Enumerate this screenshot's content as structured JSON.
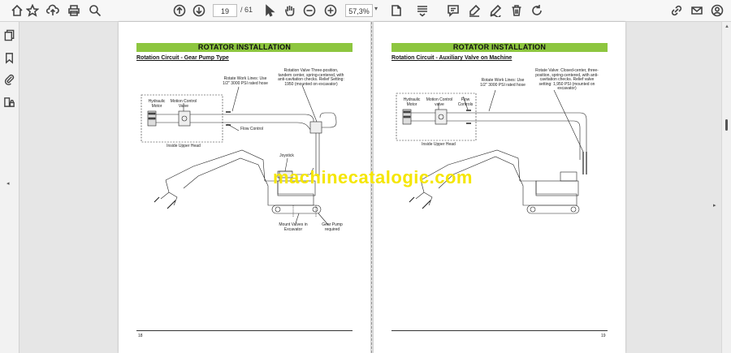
{
  "toolbar": {
    "page_current": "19",
    "page_total": "/ 61",
    "zoom": "57,3%",
    "buttons": [
      "home-icon",
      "star-icon",
      "upload-icon",
      "print-icon",
      "zoom-search-icon",
      "page-up-icon",
      "page-down-icon",
      "select-cursor-icon",
      "hand-icon",
      "zoom-out-icon",
      "zoom-in-icon",
      "fit-page-icon",
      "scroll-mode-icon",
      "comment-icon",
      "highlight-icon",
      "draw-icon",
      "delete-icon",
      "rotate-icon",
      "attach-link-icon",
      "mail-icon",
      "account-icon"
    ]
  },
  "sidebar": {
    "items": [
      "copy-pages-icon",
      "bookmark-icon",
      "attachment-icon",
      "security-icon"
    ]
  },
  "left_page": {
    "banner": "ROTATOR INSTALLATION",
    "subtitle": "Rotation Circuit - Gear Pump Type",
    "labels": {
      "hydraulic_motor": "Hydraulic Motor",
      "motion_control": "Motion Control Valve",
      "rotate_lines": "Rotate Work Lines: Use 1/2\" 3000 PSI rated hose",
      "rotation_valve": "Rotation Valve Three-position, tandem center, spring-centered, with anti-cavitation checks. Relief Setting: 1950 (mounted on excavator)",
      "flow_control": "Flow Control",
      "inside_upper_head": "Inside Upper Head",
      "joystick": "Joystick",
      "mount_valves": "Mount Valves in Excavator",
      "gear_pump": "Gear Pump required"
    },
    "page_number": "18"
  },
  "right_page": {
    "banner": "ROTATOR INSTALLATION",
    "subtitle": "Rotation Circuit - Auxiliary Valve on Machine",
    "labels": {
      "hydraulic_motor": "Hydraulic Motor",
      "motion_control": "Motion Control valve",
      "flow_controls": "Flow Controls",
      "rotate_lines": "Rotate Work Lines: Use 1/2\" 3000 PSI rated hose",
      "rotate_valve": "Rotate Valve: Closed-center, three-position, spring-centered, with anti-cavitation checks. Relief valve setting: 1,950 PSI (mounted on excavator)",
      "inside_upper_head": "Inside Upper Head"
    },
    "page_number": "19"
  },
  "watermark": "machinecatalogic.com",
  "colors": {
    "banner": "#8dc63f",
    "watermark": "#f5e600"
  }
}
